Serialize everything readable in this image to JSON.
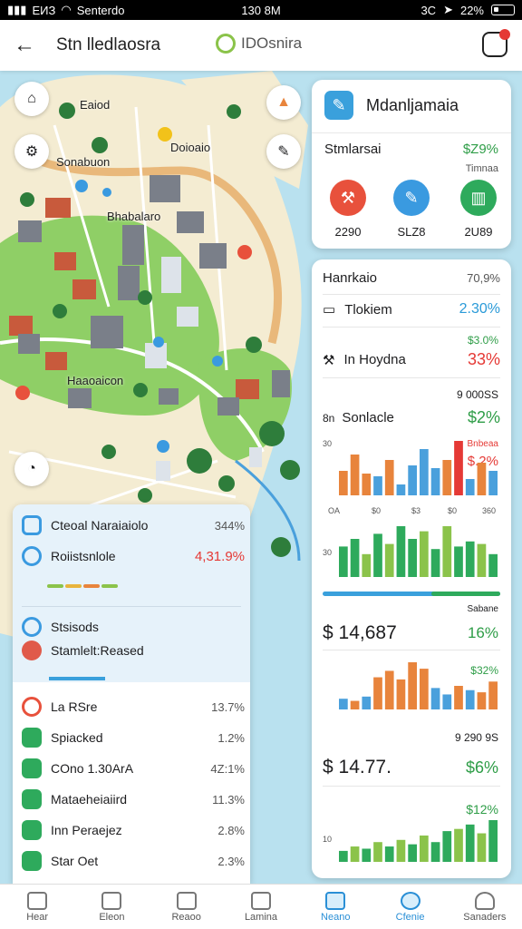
{
  "status": {
    "carrier": "ЕИЗ",
    "network": "Senterdo",
    "time": "130 8M",
    "indicators": "3C",
    "battery": "22%"
  },
  "header": {
    "title": "Stn lledlaosra",
    "center_label": "IDOsnira",
    "back_icon": "back-arrow-icon",
    "alert_icon": "alert-icon"
  },
  "map_labels": [
    "Eaiod",
    "Doioaio",
    "Sonabuon",
    "Bhabalaro",
    "Haaoaicon"
  ],
  "summary_card": {
    "title": "Mdanljamaia",
    "row_label": "Stmlarsai",
    "row_value": "$Z9%",
    "row_sub": "Timnaa",
    "buttons": [
      {
        "value": "2290",
        "color": "#e8513c",
        "icon": "tool-icon"
      },
      {
        "value": "SLZ8",
        "color": "#3a9ae0",
        "icon": "pencil-icon"
      },
      {
        "value": "2U89",
        "color": "#2eaa5c",
        "icon": "chart-icon"
      }
    ]
  },
  "stats_card": {
    "head_label": "Hanrkaio",
    "head_value": "70,9%",
    "rows": [
      {
        "label": "Tlokiem",
        "value": "2.30%",
        "color": "#2a9ad8"
      },
      {
        "label": "In Hoydna",
        "value": "33%",
        "color": "#e53935",
        "sub": "$3.0%"
      }
    ],
    "section1": {
      "small": "9 000SS",
      "label": "Sonlacle",
      "value": "$2%",
      "sub": "Bnbeaa",
      "sub2": "$.2%"
    },
    "chart1_axis": [
      "OA",
      "$0",
      "$3",
      "$0",
      "360"
    ],
    "chart1_ylabel": "30",
    "section2": {
      "small": "Sabane",
      "label": "$ 14,687",
      "value": "16%"
    },
    "section3": {
      "sub": "$32%",
      "small": "9 290 9S",
      "label": "$ 14.77.",
      "value": "$6%",
      "sub2": "$12%"
    },
    "chart_y_small": "30",
    "chart_y_small2": "10"
  },
  "list_card": {
    "top_rows": [
      {
        "label": "Cteoal Naraiaiolo",
        "value": "344%",
        "icon_color": "#3a9ae0"
      },
      {
        "label": "Roiistsnlole",
        "value": "4,31.9%",
        "icon_color": "#3a9ae0"
      }
    ],
    "mid_rows": [
      {
        "label": "Stsisods",
        "icon_color": "#3a9ae0"
      },
      {
        "label": "Stamlelt:Reased",
        "icon_color": "#e05a4a"
      }
    ],
    "rows": [
      {
        "label": "La RSre",
        "value": "13.7%",
        "icon_color": "#e8513c"
      },
      {
        "label": "Spiacked",
        "value": "1.2%",
        "icon_color": "#2eaa5c"
      },
      {
        "label": "COno 1.30ArA",
        "value": "4Z:1%",
        "icon_color": "#2eaa5c"
      },
      {
        "label": "Mataeheiaiird",
        "value": "11.3%",
        "icon_color": "#2eaa5c"
      },
      {
        "label": "Inn Peraejez",
        "value": "2.8%",
        "icon_color": "#2eaa5c"
      },
      {
        "label": "Star Oet",
        "value": "2.3%",
        "icon_color": "#2eaa5c"
      }
    ]
  },
  "chart_data": [
    {
      "type": "bar",
      "values": [
        18,
        30,
        16,
        14,
        26,
        8,
        22,
        34,
        20,
        26,
        40,
        12,
        24,
        18
      ],
      "colors": [
        "#e8843c",
        "#e8843c",
        "#e8843c",
        "#4aa0dc",
        "#e8843c",
        "#4aa0dc",
        "#4aa0dc",
        "#4aa0dc",
        "#4aa0dc",
        "#e8843c",
        "#e53935",
        "#4aa0dc",
        "#e8843c",
        "#4aa0dc"
      ]
    },
    {
      "type": "bar",
      "values": [
        24,
        30,
        18,
        34,
        26,
        40,
        30,
        36,
        22,
        40,
        24,
        28,
        26,
        18
      ],
      "colors": [
        "#2eaa5c",
        "#2eaa5c",
        "#8bc34a",
        "#2eaa5c",
        "#8bc34a",
        "#2eaa5c",
        "#2eaa5c",
        "#8bc34a",
        "#2eaa5c",
        "#8bc34a",
        "#2eaa5c",
        "#2eaa5c",
        "#8bc34a",
        "#2eaa5c"
      ]
    },
    {
      "type": "bar",
      "values": [
        10,
        8,
        12,
        30,
        36,
        28,
        44,
        38,
        20,
        14,
        22,
        18,
        16,
        26
      ],
      "colors": [
        "#4aa0dc",
        "#e8843c",
        "#4aa0dc",
        "#e8843c",
        "#e8843c",
        "#e8843c",
        "#e8843c",
        "#e8843c",
        "#4aa0dc",
        "#4aa0dc",
        "#e8843c",
        "#4aa0dc",
        "#e8843c",
        "#e8843c"
      ]
    },
    {
      "type": "bar",
      "values": [
        10,
        14,
        12,
        18,
        14,
        20,
        16,
        24,
        18,
        28,
        30,
        34,
        26,
        38
      ],
      "colors": [
        "#2eaa5c",
        "#8bc34a",
        "#2eaa5c",
        "#8bc34a",
        "#2eaa5c",
        "#8bc34a",
        "#2eaa5c",
        "#8bc34a",
        "#2eaa5c",
        "#2eaa5c",
        "#8bc34a",
        "#2eaa5c",
        "#8bc34a",
        "#2eaa5c"
      ]
    }
  ],
  "bottom_nav": [
    {
      "label": "Hear",
      "icon": "home-icon"
    },
    {
      "label": "Eleon",
      "icon": "book-icon"
    },
    {
      "label": "Reaoo",
      "icon": "list-icon"
    },
    {
      "label": "Lamina",
      "icon": "camera-icon"
    },
    {
      "label": "Neano",
      "icon": "map-icon",
      "active": true
    },
    {
      "label": "Cfenie",
      "icon": "globe-icon",
      "active": true
    },
    {
      "label": "Sanaders",
      "icon": "person-icon"
    }
  ]
}
